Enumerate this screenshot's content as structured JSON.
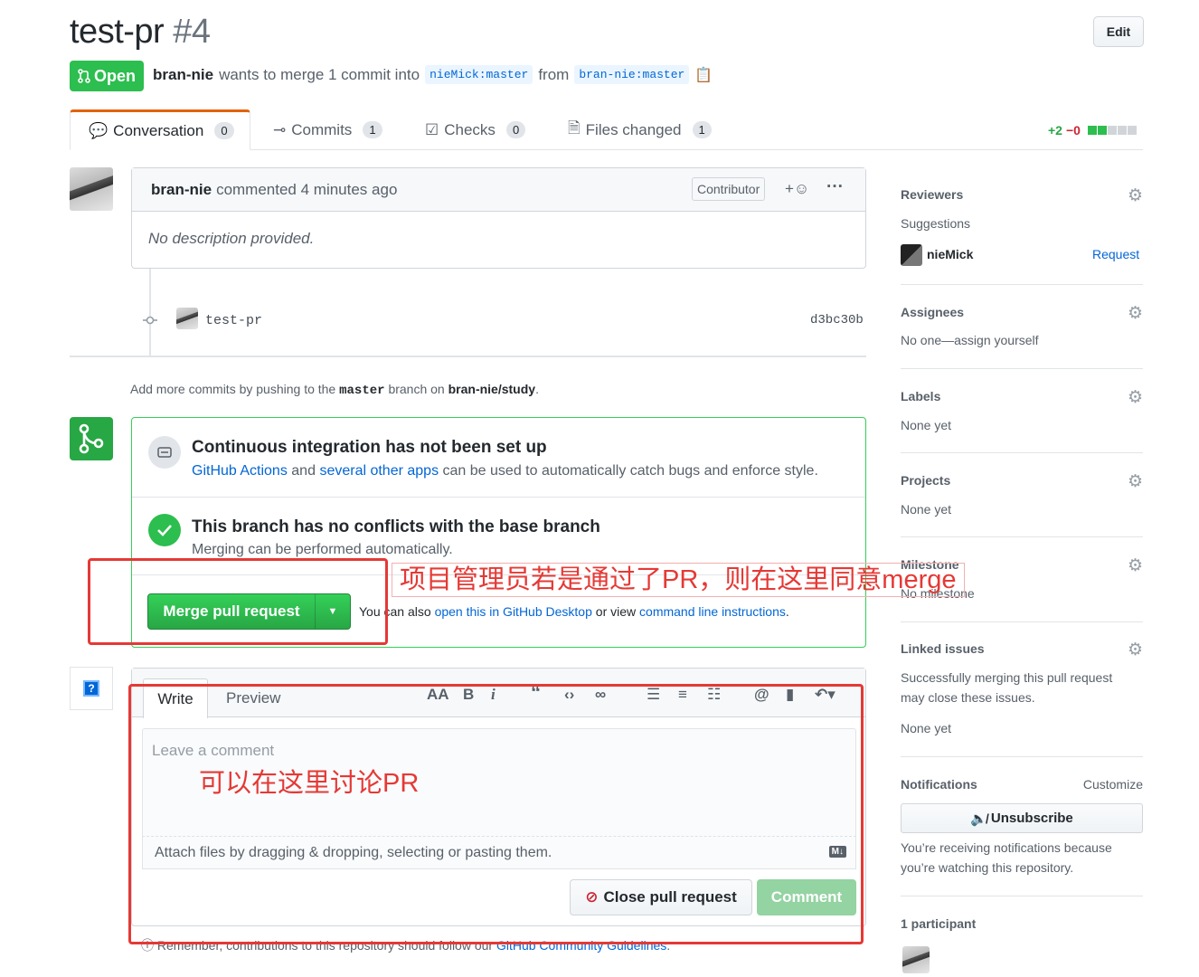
{
  "header": {
    "title": "test-pr",
    "number": "#4",
    "edit_label": "Edit",
    "state": "Open",
    "author": "bran-nie",
    "merge_text": "wants to merge 1 commit into",
    "base_branch": "nieMick:master",
    "from_text": "from",
    "head_branch": "bran-nie:master"
  },
  "tabs": [
    {
      "label": "Conversation",
      "count": "0"
    },
    {
      "label": "Commits",
      "count": "1"
    },
    {
      "label": "Checks",
      "count": "0"
    },
    {
      "label": "Files changed",
      "count": "1"
    }
  ],
  "diffstat": {
    "added": "+2",
    "removed": "−0"
  },
  "comment": {
    "author": "bran-nie",
    "time": "commented 4 minutes ago",
    "badge": "Contributor",
    "body": "No description provided."
  },
  "commit": {
    "message": "test-pr",
    "sha": "d3bc30b"
  },
  "push_hint": {
    "pre": "Add more commits by pushing to the",
    "branch": "master",
    "mid": "branch on",
    "repo": "bran-nie/study",
    "post": "."
  },
  "merge": {
    "ci_title": "Continuous integration has not been set up",
    "ci_link1": "GitHub Actions",
    "ci_and": "and",
    "ci_link2": "several other apps",
    "ci_rest": "can be used to automatically catch bugs and enforce style.",
    "conflict_title": "This branch has no conflicts with the base branch",
    "conflict_sub": "Merging can be performed automatically.",
    "merge_button": "Merge pull request",
    "also_text": "You can also",
    "desktop_link": "open this in GitHub Desktop",
    "or_view": "or view",
    "cli_link": "command line instructions",
    "period": "."
  },
  "compose": {
    "write_tab": "Write",
    "preview_tab": "Preview",
    "placeholder": "Leave a comment",
    "attach": "Attach files by dragging & dropping, selecting or pasting them.",
    "close_button": "Close pull request",
    "comment_button": "Comment",
    "footer_pre": "Remember, contributions to this repository should follow our",
    "footer_link": "GitHub Community Guidelines",
    "footer_post": "."
  },
  "sidebar": {
    "reviewers": {
      "title": "Reviewers",
      "suggestions": "Suggestions",
      "user": "nieMick",
      "request": "Request"
    },
    "assignees": {
      "title": "Assignees",
      "text": "No one—assign yourself"
    },
    "labels": {
      "title": "Labels",
      "text": "None yet"
    },
    "projects": {
      "title": "Projects",
      "text": "None yet"
    },
    "milestone": {
      "title": "Milestone",
      "text": "No milestone"
    },
    "linked": {
      "title": "Linked issues",
      "text1": "Successfully merging this pull request",
      "text2": "may close these issues.",
      "text3": "None yet"
    },
    "notifications": {
      "title": "Notifications",
      "customize": "Customize",
      "button": "Unsubscribe",
      "reason1": "You’re receiving notifications because",
      "reason2": "you’re watching this repository."
    },
    "participants": {
      "title": "1 participant"
    }
  },
  "annotations": {
    "merge_note": "项目管理员若是通过了PR，则在这里同意merge",
    "discuss_note": "可以在这里讨论PR"
  },
  "colors": {
    "open_green": "#2cbe4e",
    "link_blue": "#0366d6",
    "annotation_red": "#e53935"
  }
}
